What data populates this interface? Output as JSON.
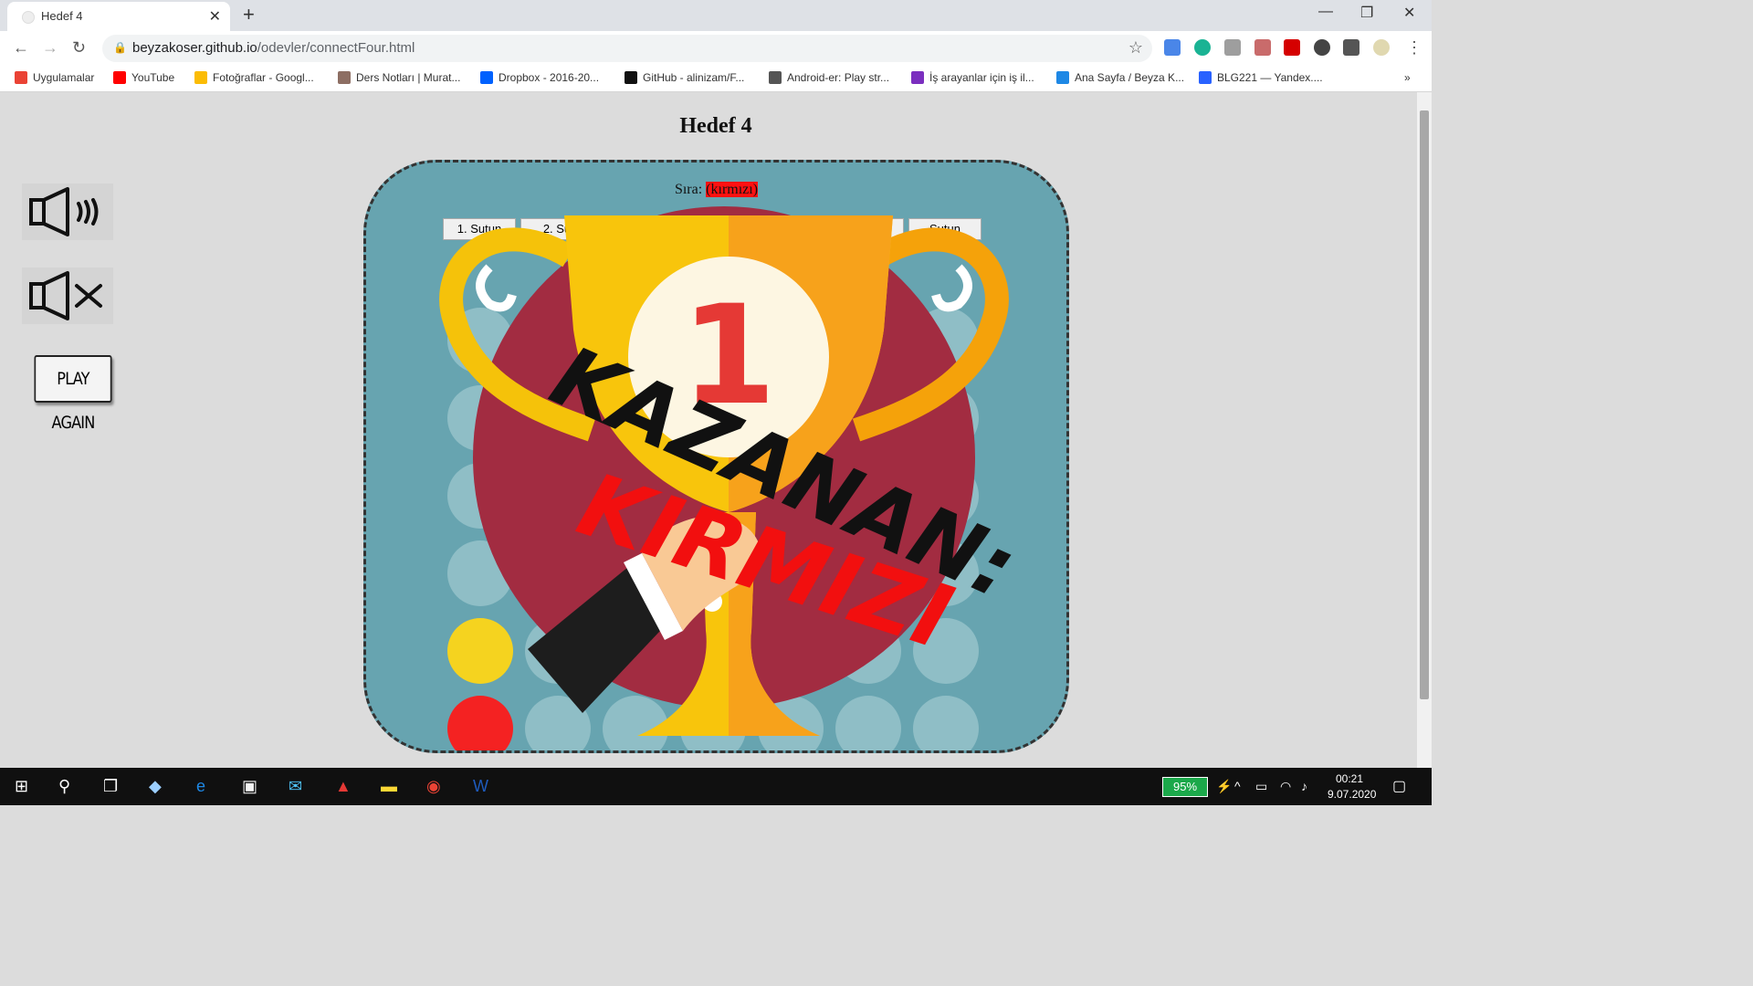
{
  "browser": {
    "tab_title": "Hedef 4",
    "new_tab": "+",
    "minimize": "—",
    "restore": "❐",
    "close": "✕",
    "url_host": "beyzakoser.github.io",
    "url_path": "/odevler/connectFour.html",
    "bookmarks": [
      {
        "label": "Uygulamalar",
        "color": "#ea4335"
      },
      {
        "label": "YouTube",
        "color": "#ff0000"
      },
      {
        "label": "Fotoğraflar - Googl...",
        "color": "#fbbc05"
      },
      {
        "label": "Ders Notları | Murat...",
        "color": "#8d6e63"
      },
      {
        "label": "Dropbox - 2016-20...",
        "color": "#0061fe"
      },
      {
        "label": "GitHub - alinizam/F...",
        "color": "#111111"
      },
      {
        "label": "Android-er: Play str...",
        "color": "#555555"
      },
      {
        "label": "İş arayanlar için iş il...",
        "color": "#7b2fbf"
      },
      {
        "label": "Ana Sayfa / Beyza K...",
        "color": "#1e88e5"
      },
      {
        "label": "BLG221 — Yandex....",
        "color": "#2962ff"
      }
    ],
    "more_bookmarks": "»"
  },
  "page": {
    "heading": "Hedef 4",
    "turn_label": "Sıra:",
    "turn_value": "(kırmızı)",
    "play_again": "PLAY AGAIN",
    "sound_on_icon": "speaker-on-icon",
    "sound_off_icon": "speaker-mute-icon",
    "column_buttons": [
      "1. Sutun",
      "2. Su",
      "",
      "",
      "",
      "",
      "Sutun"
    ],
    "winner_line1": "KAZANAN:",
    "winner_line2": "KIRMIZI",
    "trophy_number": "1",
    "board": {
      "rows": 6,
      "cols": 7,
      "filled": [
        {
          "row": 4,
          "col": 0,
          "color": "yellow"
        },
        {
          "row": 5,
          "col": 0,
          "color": "red"
        }
      ]
    },
    "colors": {
      "red_player": "#f42222",
      "yellow_player": "#f5d31f",
      "board": "#67a4b0"
    }
  },
  "taskbar": {
    "battery": "95%",
    "time": "00:21",
    "date": "9.07.2020"
  }
}
